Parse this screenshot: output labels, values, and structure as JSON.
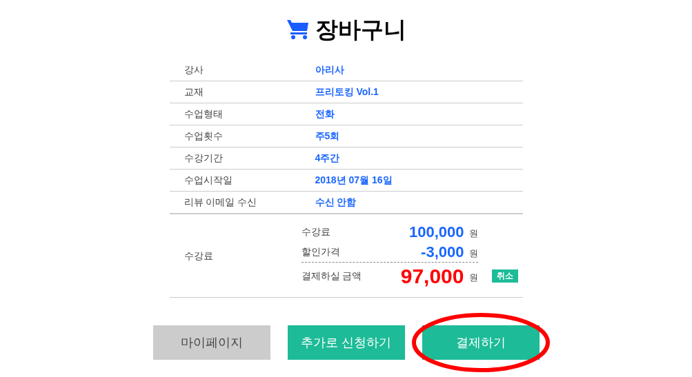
{
  "title": "장바구니",
  "details": [
    {
      "label": "강사",
      "value": "아리사"
    },
    {
      "label": "교재",
      "value": "프리토킹 Vol.1"
    },
    {
      "label": "수업형태",
      "value": "전화"
    },
    {
      "label": "수업횟수",
      "value": "주5회"
    },
    {
      "label": "수강기간",
      "value": "4주간"
    },
    {
      "label": "수업시작일",
      "value": "2018년 07월 16일"
    },
    {
      "label": "리뷰 이메일 수신",
      "value": "수신 안함"
    }
  ],
  "fee": {
    "label": "수강료",
    "items": [
      {
        "kind": "normal",
        "label": "수강료",
        "amount": "100,000",
        "unit": "원"
      },
      {
        "kind": "normal",
        "label": "할인가격",
        "amount": "-3,000",
        "unit": "원"
      },
      {
        "kind": "total",
        "label": "결제하실 금액",
        "amount": "97,000",
        "unit": "원"
      }
    ],
    "cancel_button": "취소"
  },
  "buttons": [
    {
      "kind": "secondary",
      "label": "마이페이지",
      "highlighted": false
    },
    {
      "kind": "primary",
      "label": "추가로 신청하기",
      "highlighted": false
    },
    {
      "kind": "primary",
      "label": "결제하기",
      "highlighted": true
    }
  ]
}
